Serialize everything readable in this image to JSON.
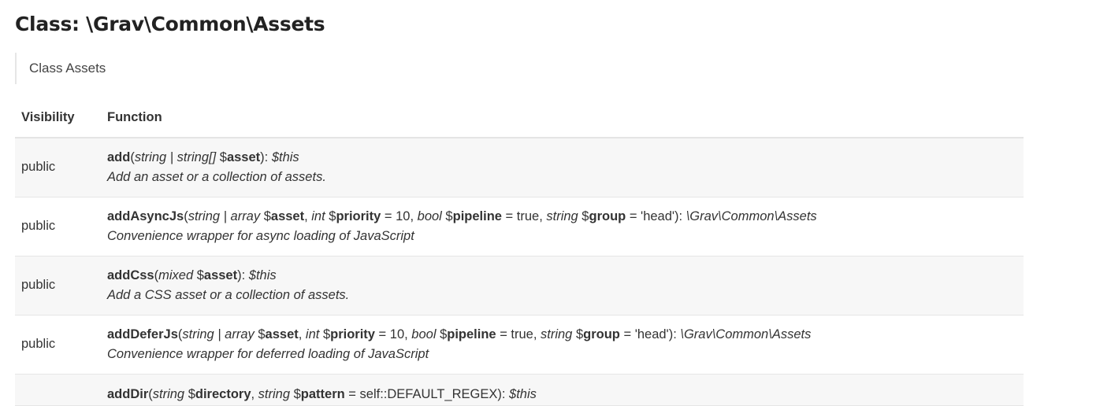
{
  "page": {
    "title": "Class: \\Grav\\Common\\Assets",
    "summary": "Class Assets"
  },
  "table": {
    "headers": {
      "visibility": "Visibility",
      "function": "Function"
    },
    "rows": [
      {
        "visibility": "public",
        "signature": [
          {
            "t": "add",
            "s": "b"
          },
          {
            "t": "(",
            "s": ""
          },
          {
            "t": "string | string[]",
            "s": "i"
          },
          {
            "t": " $",
            "s": ""
          },
          {
            "t": "asset",
            "s": "b"
          },
          {
            "t": "): ",
            "s": ""
          },
          {
            "t": "$this",
            "s": "i"
          }
        ],
        "description": "Add an asset or a collection of assets."
      },
      {
        "visibility": "public",
        "signature": [
          {
            "t": "addAsyncJs",
            "s": "b"
          },
          {
            "t": "(",
            "s": ""
          },
          {
            "t": "string | array",
            "s": "i"
          },
          {
            "t": " $",
            "s": ""
          },
          {
            "t": "asset",
            "s": "b"
          },
          {
            "t": ", ",
            "s": ""
          },
          {
            "t": "int",
            "s": "i"
          },
          {
            "t": " $",
            "s": ""
          },
          {
            "t": "priority",
            "s": "b"
          },
          {
            "t": " = 10, ",
            "s": ""
          },
          {
            "t": "bool",
            "s": "i"
          },
          {
            "t": " $",
            "s": ""
          },
          {
            "t": "pipeline",
            "s": "b"
          },
          {
            "t": " = true, ",
            "s": ""
          },
          {
            "t": "string",
            "s": "i"
          },
          {
            "t": " $",
            "s": ""
          },
          {
            "t": "group",
            "s": "b"
          },
          {
            "t": " = 'head'): ",
            "s": ""
          },
          {
            "t": "\\Grav\\Common\\Assets",
            "s": "i"
          }
        ],
        "description": "Convenience wrapper for async loading of JavaScript"
      },
      {
        "visibility": "public",
        "signature": [
          {
            "t": "addCss",
            "s": "b"
          },
          {
            "t": "(",
            "s": ""
          },
          {
            "t": "mixed",
            "s": "i"
          },
          {
            "t": " $",
            "s": ""
          },
          {
            "t": "asset",
            "s": "b"
          },
          {
            "t": "): ",
            "s": ""
          },
          {
            "t": "$this",
            "s": "i"
          }
        ],
        "description": "Add a CSS asset or a collection of assets."
      },
      {
        "visibility": "public",
        "signature": [
          {
            "t": "addDeferJs",
            "s": "b"
          },
          {
            "t": "(",
            "s": ""
          },
          {
            "t": "string | array",
            "s": "i"
          },
          {
            "t": " $",
            "s": ""
          },
          {
            "t": "asset",
            "s": "b"
          },
          {
            "t": ", ",
            "s": ""
          },
          {
            "t": "int",
            "s": "i"
          },
          {
            "t": " $",
            "s": ""
          },
          {
            "t": "priority",
            "s": "b"
          },
          {
            "t": " = 10, ",
            "s": ""
          },
          {
            "t": "bool",
            "s": "i"
          },
          {
            "t": " $",
            "s": ""
          },
          {
            "t": "pipeline",
            "s": "b"
          },
          {
            "t": " = true, ",
            "s": ""
          },
          {
            "t": "string",
            "s": "i"
          },
          {
            "t": " $",
            "s": ""
          },
          {
            "t": "group",
            "s": "b"
          },
          {
            "t": " = 'head'): ",
            "s": ""
          },
          {
            "t": "\\Grav\\Common\\Assets",
            "s": "i"
          }
        ],
        "description": "Convenience wrapper for deferred loading of JavaScript"
      }
    ],
    "partial_row_signature": [
      {
        "t": "addDir",
        "s": "b"
      },
      {
        "t": "(",
        "s": ""
      },
      {
        "t": "string",
        "s": "i"
      },
      {
        "t": " $",
        "s": ""
      },
      {
        "t": "directory",
        "s": "b"
      },
      {
        "t": ", ",
        "s": ""
      },
      {
        "t": "string",
        "s": "i"
      },
      {
        "t": " $",
        "s": ""
      },
      {
        "t": "pattern",
        "s": "b"
      },
      {
        "t": " = self::DEFAULT_REGEX): ",
        "s": ""
      },
      {
        "t": "$this",
        "s": "i"
      }
    ]
  }
}
